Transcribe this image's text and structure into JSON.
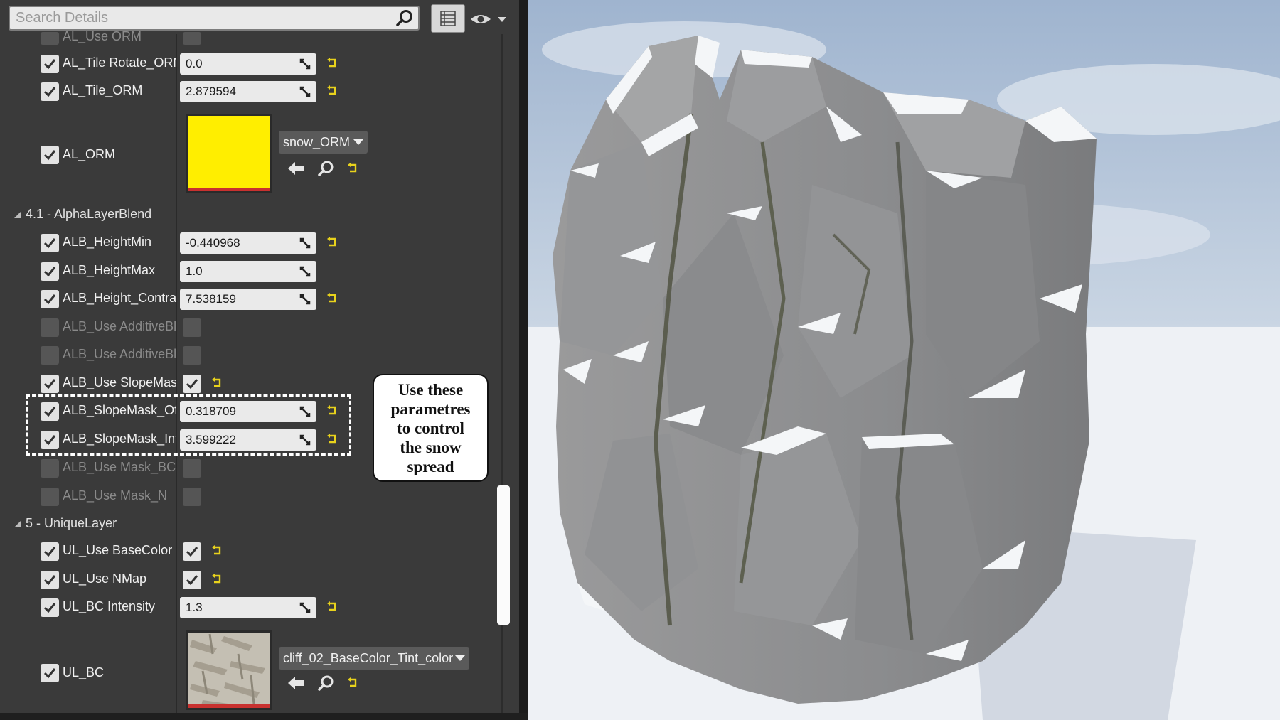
{
  "search": {
    "placeholder": "Search Details"
  },
  "toolbar": {
    "view_options_icon": "grid-list-icon",
    "visibility_icon": "eye-icon"
  },
  "properties": {
    "use_orm_cut": "AL_Use ORM",
    "tile_rotate_orm": {
      "label": "AL_Tile Rotate_ORM",
      "value": "0.0"
    },
    "tile_orm": {
      "label": "AL_Tile_ORM",
      "value": "2.879594"
    },
    "al_orm": {
      "label": "AL_ORM",
      "asset": "snow_ORM",
      "color": "#ffee00"
    }
  },
  "alpha_layer_blend": {
    "category": "4.1 - AlphaLayerBlend",
    "height_min": {
      "label": "ALB_HeightMin",
      "value": "-0.440968"
    },
    "height_max": {
      "label": "ALB_HeightMax",
      "value": "1.0"
    },
    "height_contrast": {
      "label": "ALB_Height_Contrast",
      "value": "7.538159"
    },
    "use_additive_1": {
      "label": "ALB_Use AdditiveBlend"
    },
    "use_additive_2": {
      "label": "ALB_Use AdditiveBlend"
    },
    "use_slope_mask": {
      "label": "ALB_Use SlopeMask",
      "checked": true
    },
    "slope_mask_offset": {
      "label": "ALB_SlopeMask_Offset",
      "value": "0.318709"
    },
    "slope_mask_intensity": {
      "label": "ALB_SlopeMask_Intensity",
      "value": "3.599222"
    },
    "use_mask_bc": {
      "label": "ALB_Use Mask_BC"
    },
    "use_mask_n": {
      "label": "ALB_Use Mask_N"
    }
  },
  "unique_layer": {
    "category": "5 - UniqueLayer",
    "use_base_color": {
      "label": "UL_Use BaseColor",
      "checked": true
    },
    "use_nmap": {
      "label": "UL_Use NMap",
      "checked": true
    },
    "bc_intensity": {
      "label": "UL_BC Intensity",
      "value": "1.3"
    },
    "ul_bc": {
      "label": "UL_BC",
      "asset": "cliff_02_BaseColor_Tint_color"
    }
  },
  "callout": {
    "text": "Use these\nparametres\nto control\nthe snow\nspread"
  },
  "colors": {
    "panel_bg": "#3a3a3a",
    "reset_arrow": "#e8d21c",
    "sky": "#b8c8dc",
    "rock": "#8f9091",
    "snow": "#f4f6f8"
  }
}
